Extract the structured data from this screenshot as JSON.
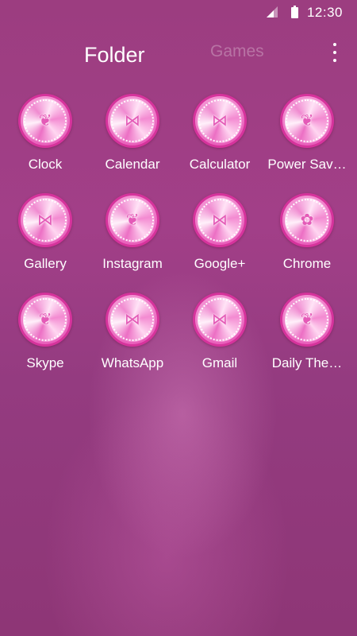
{
  "status_bar": {
    "time": "12:30",
    "signal_icon": "signal-icon",
    "battery_icon": "battery-icon"
  },
  "header": {
    "tabs": [
      {
        "label": "Folder",
        "active": true
      },
      {
        "label": "Games",
        "active": false
      }
    ],
    "menu_icon": "more-vert-icon"
  },
  "apps": [
    {
      "label": "Clock",
      "glyph": "❦"
    },
    {
      "label": "Calendar",
      "glyph": "⋈"
    },
    {
      "label": "Calculator",
      "glyph": "⋈"
    },
    {
      "label": "Power Sav…",
      "glyph": "❦"
    },
    {
      "label": "Gallery",
      "glyph": "⋈"
    },
    {
      "label": "Instagram",
      "glyph": "❦"
    },
    {
      "label": "Google+",
      "glyph": "⋈"
    },
    {
      "label": "Chrome",
      "glyph": "✿"
    },
    {
      "label": "Skype",
      "glyph": "❦"
    },
    {
      "label": "WhatsApp",
      "glyph": "⋈"
    },
    {
      "label": "Gmail",
      "glyph": "⋈"
    },
    {
      "label": "Daily The…",
      "glyph": "❦"
    }
  ],
  "colors": {
    "background": "#9c3d80",
    "icon_rim": "#d6339c",
    "inactive_tab": "rgba(255,255,255,0.28)"
  }
}
